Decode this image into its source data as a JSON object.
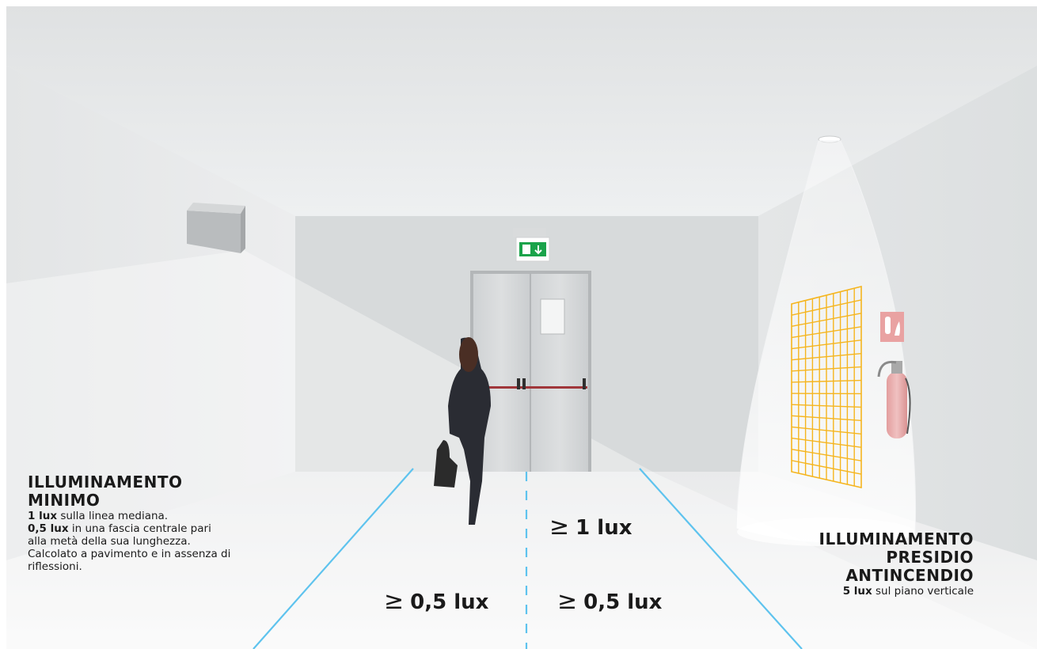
{
  "left_info": {
    "title": "ILLUMINAMENTO MINIMO",
    "line1_bold": "1 lux",
    "line1_rest": " sulla linea mediana.",
    "line2_bold": "0,5 lux",
    "line2_rest": " in una fascia centrale pari alla metà della sua lunghezza. Calcolato a pavimento e in assenza di riflessioni."
  },
  "right_info": {
    "title": "ILLUMINAMENTO PRESIDIO ANTINCENDIO",
    "line_bold": "5 lux",
    "line_rest": " sul piano verticale"
  },
  "lux_labels": {
    "symbol": "≥",
    "center": "1 lux",
    "left": "0,5 lux",
    "right": "0,5 lux"
  },
  "colors": {
    "line_blue": "#5ec3ee",
    "grid_orange": "#f5b51e",
    "exit_green": "#1aa34a",
    "extinguisher": "#e7a3a3"
  },
  "icons": {
    "exit_sign": "emergency-exit-icon",
    "fire_sign": "fire-extinguisher-sign-icon"
  }
}
